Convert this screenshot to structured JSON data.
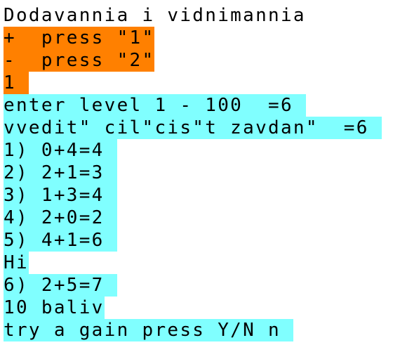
{
  "colors": {
    "console_bg": "#ffffff",
    "text": "#000000",
    "menu_highlight": "#ff8000",
    "output_highlight": "#80ffff"
  },
  "console": {
    "lines": [
      {
        "text": "Dodavannia i vidnimannia",
        "highlight": "none"
      },
      {
        "text": "+  press \"1\"",
        "highlight": "orange"
      },
      {
        "text": "-  press \"2\"",
        "highlight": "orange"
      },
      {
        "text": "1 ",
        "highlight": "orange"
      },
      {
        "text": "enter level 1 - 100  =6 ",
        "highlight": "cyan"
      },
      {
        "text": "vvedit\" cil\"cis\"t zavdan\"  =6 ",
        "highlight": "cyan"
      },
      {
        "text": "1) 0+4=4 ",
        "highlight": "cyan"
      },
      {
        "text": "2) 2+1=3 ",
        "highlight": "cyan"
      },
      {
        "text": "3) 1+3=4 ",
        "highlight": "cyan"
      },
      {
        "text": "4) 2+0=2 ",
        "highlight": "cyan"
      },
      {
        "text": "5) 4+1=6 ",
        "highlight": "cyan"
      },
      {
        "text": "Hi",
        "highlight": "cyan"
      },
      {
        "text": "6) 2+5=7 ",
        "highlight": "cyan"
      },
      {
        "text": "10 baliv",
        "highlight": "cyan"
      },
      {
        "text": "try a gain press Y/N n ",
        "highlight": "cyan"
      }
    ]
  }
}
